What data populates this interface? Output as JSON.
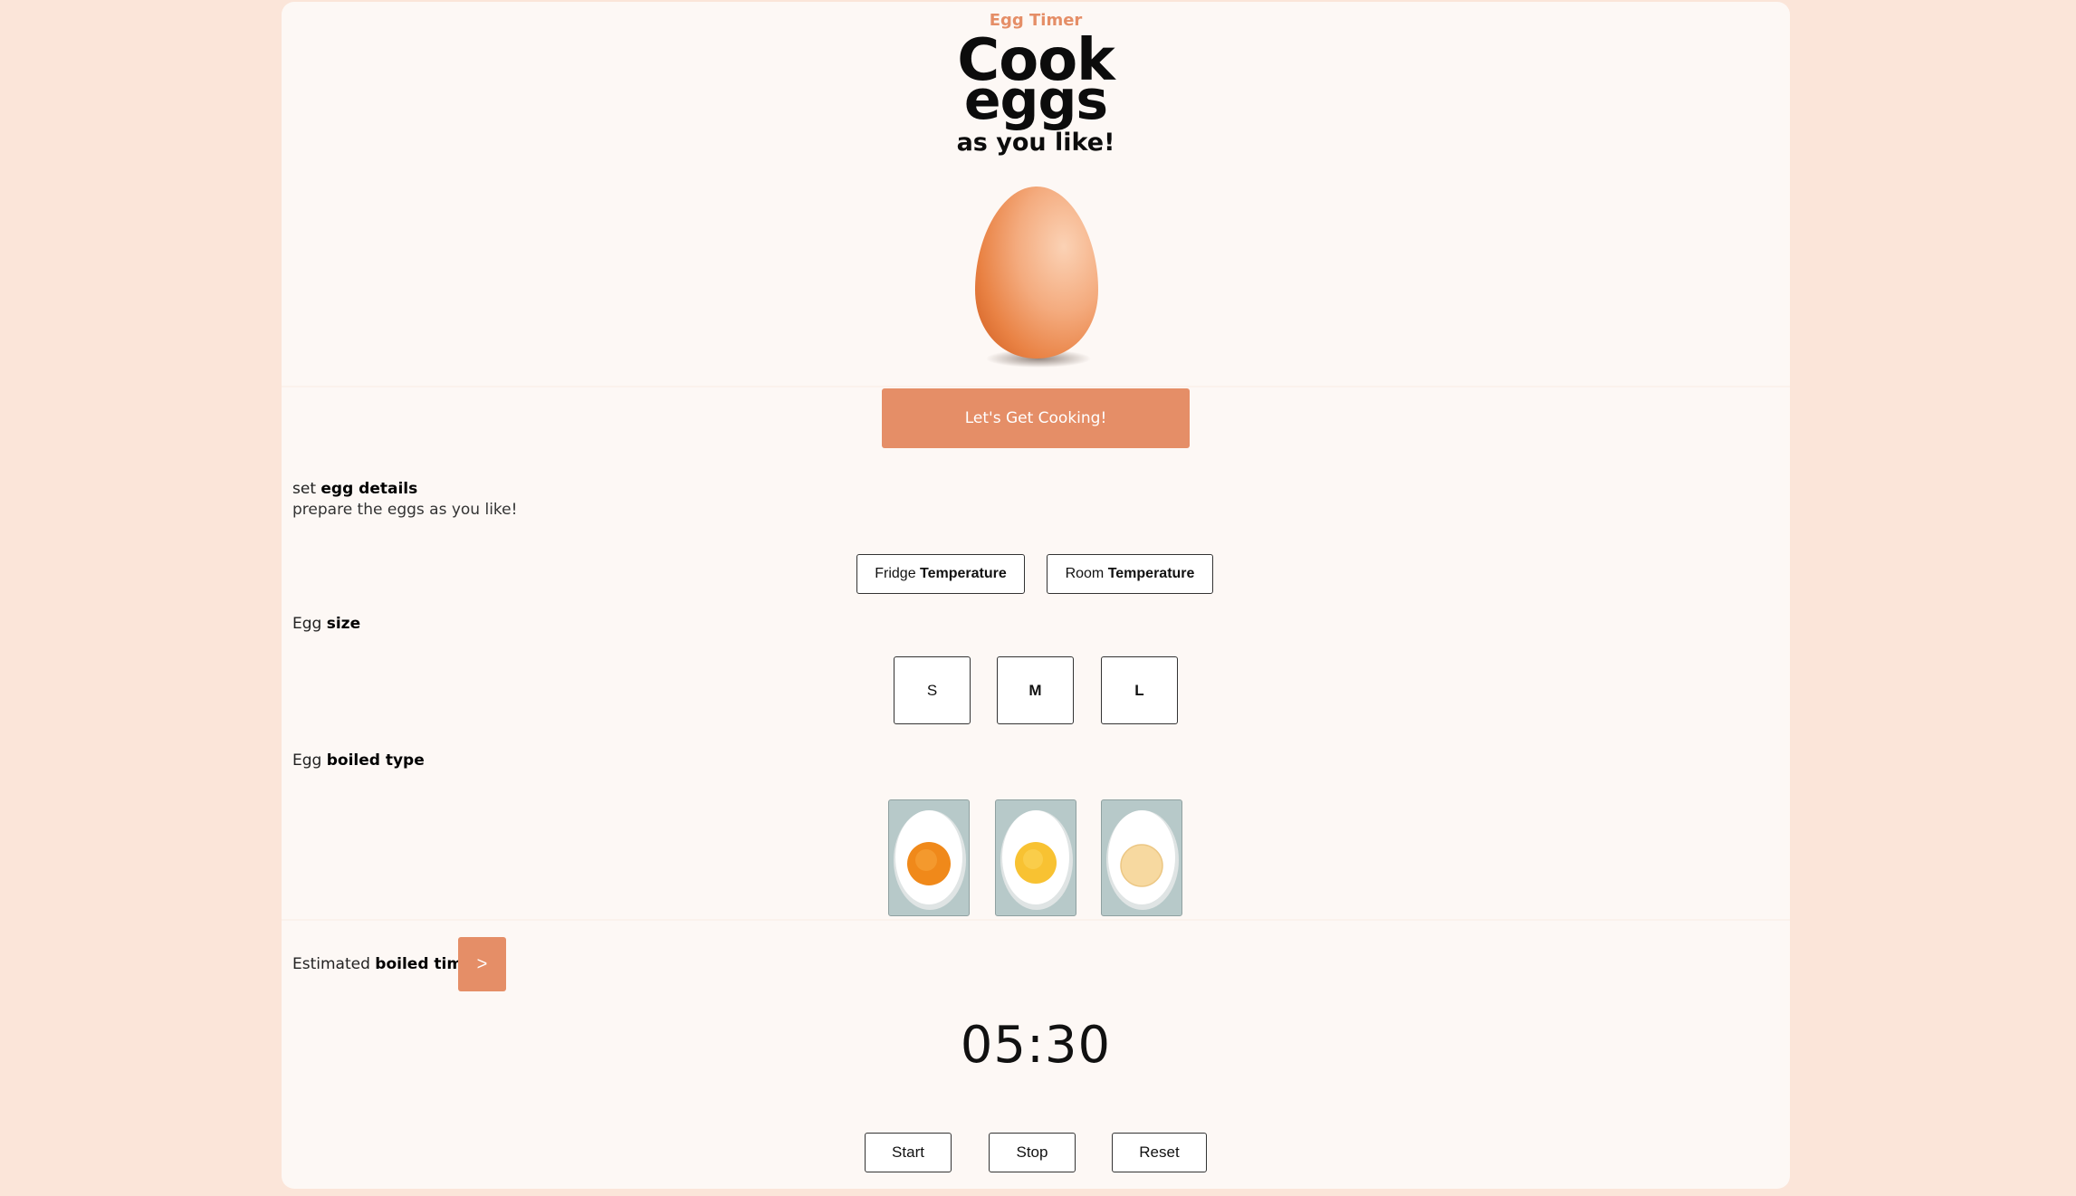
{
  "app": {
    "eyebrow": "Egg Timer",
    "hero_line1": "Cook",
    "hero_line2": "eggs",
    "hero_line3": "as you like!",
    "cta_label": "Let's Get Cooking!"
  },
  "details": {
    "heading_prefix": "set ",
    "heading_bold": "egg details",
    "subheading": "prepare the eggs as you like!"
  },
  "temperature": {
    "options": [
      {
        "prefix": "Fridge ",
        "bold": "Temperature"
      },
      {
        "prefix": "Room ",
        "bold": "Temperature"
      }
    ]
  },
  "size": {
    "label_prefix": "Egg ",
    "label_bold": "size",
    "options": [
      "S",
      "M",
      "L"
    ],
    "selected": "M"
  },
  "boil": {
    "label_prefix": "Egg ",
    "label_bold": "boiled type",
    "yolk_colors": [
      "#f0891a",
      "#f8c232",
      "#f7d9a0"
    ]
  },
  "estimate": {
    "label_prefix": "Estimated ",
    "label_bold": "boiled time",
    "arrow_label": ">",
    "timer": "05:30"
  },
  "controls": {
    "start": "Start",
    "stop": "Stop",
    "reset": "Reset"
  },
  "colors": {
    "accent": "#e58e67",
    "page_bg": "#fbe5d9",
    "card_bg": "#fdf8f5"
  }
}
